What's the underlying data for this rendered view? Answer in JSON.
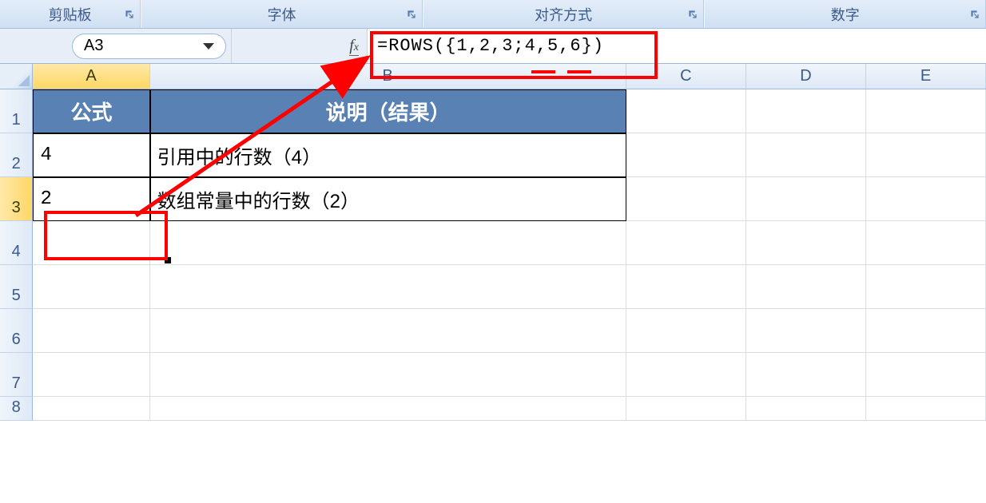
{
  "ribbon": {
    "groups": [
      "剪贴板",
      "字体",
      "对齐方式",
      "数字"
    ]
  },
  "name_box": "A3",
  "formula": "=ROWS({1,2,3;4,5,6})",
  "columns": [
    "A",
    "B",
    "C",
    "D",
    "E"
  ],
  "row_numbers": [
    "1",
    "2",
    "3",
    "4",
    "5",
    "6",
    "7",
    "8"
  ],
  "active_cell": "A3",
  "table": {
    "header_a": "公式",
    "header_b": "说明（结果）",
    "r2": {
      "a": "4",
      "b": "引用中的行数（4）"
    },
    "r3": {
      "a": "2",
      "b": "数组常量中的行数（2）"
    }
  }
}
